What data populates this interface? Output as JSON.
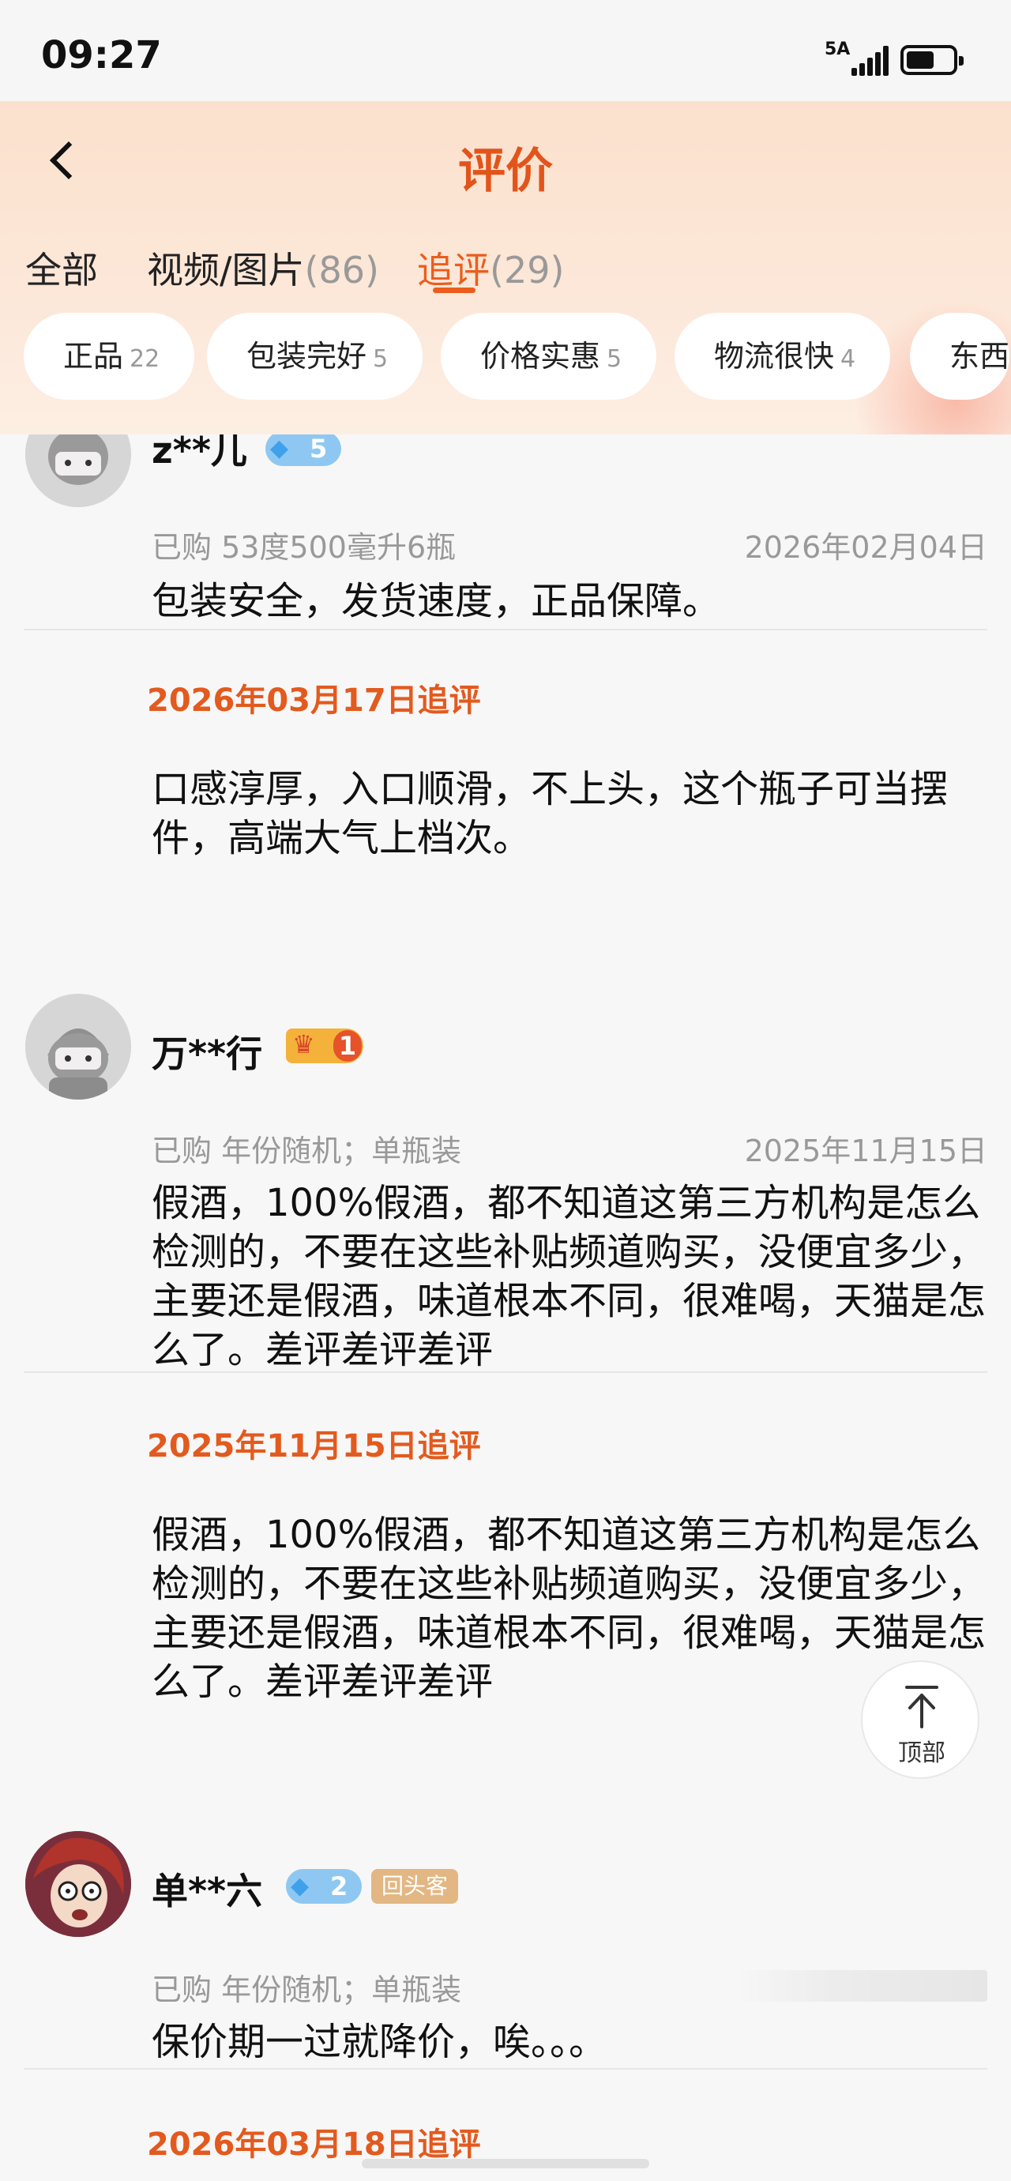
{
  "status_bar": {
    "time": "09:27",
    "network": "5A"
  },
  "header": {
    "title": "评价"
  },
  "tabs": [
    {
      "label": "全部",
      "count": ""
    },
    {
      "label": "视频/图片",
      "count": "(86)"
    },
    {
      "label": "追评",
      "count": "(29)",
      "active": true
    }
  ],
  "filter_chips": [
    {
      "label": "正品",
      "count": "22"
    },
    {
      "label": "包装完好",
      "count": "5"
    },
    {
      "label": "价格实惠",
      "count": "5"
    },
    {
      "label": "物流很快",
      "count": "4"
    },
    {
      "label": "东西",
      "count": ""
    }
  ],
  "reviews": [
    {
      "user": "z**儿",
      "badge_level": "5",
      "purchase": "已购 53度500毫升6瓶",
      "date": "2026年02月04日",
      "text": "包装安全，发货速度，正品保障。",
      "followup_date": "2026年03月17日追评",
      "followup_text": "口感淳厚，入口顺滑，不上头，这个瓶子可当摆件，高端大气上档次。"
    },
    {
      "user": "万**行",
      "badge_level": "1",
      "purchase": "已购 年份随机；单瓶装",
      "date": "2025年11月15日",
      "text": "假酒，100%假酒，都不知道这第三方机构是怎么检测的，不要在这些补贴频道购买，没便宜多少，主要还是假酒，味道根本不同，很难喝，天猫是怎么了。差评差评差评",
      "followup_date": "2025年11月15日追评",
      "followup_text": "假酒，100%假酒，都不知道这第三方机构是怎么检测的，不要在这些补贴频道购买，没便宜多少，主要还是假酒，味道根本不同，很难喝，天猫是怎么了。差评差评差评"
    },
    {
      "user": "单**六",
      "badge_level": "2",
      "tag": "回头客",
      "purchase": "已购 年份随机；单瓶装",
      "text": "保价期一过就降价，唉。。。",
      "followup_date": "2026年03月18日追评"
    }
  ],
  "back_to_top": {
    "label": "顶部"
  },
  "colors": {
    "accent": "#ec5c1c",
    "followup": "#e35a1e",
    "header_bg": "#fce3d0"
  }
}
